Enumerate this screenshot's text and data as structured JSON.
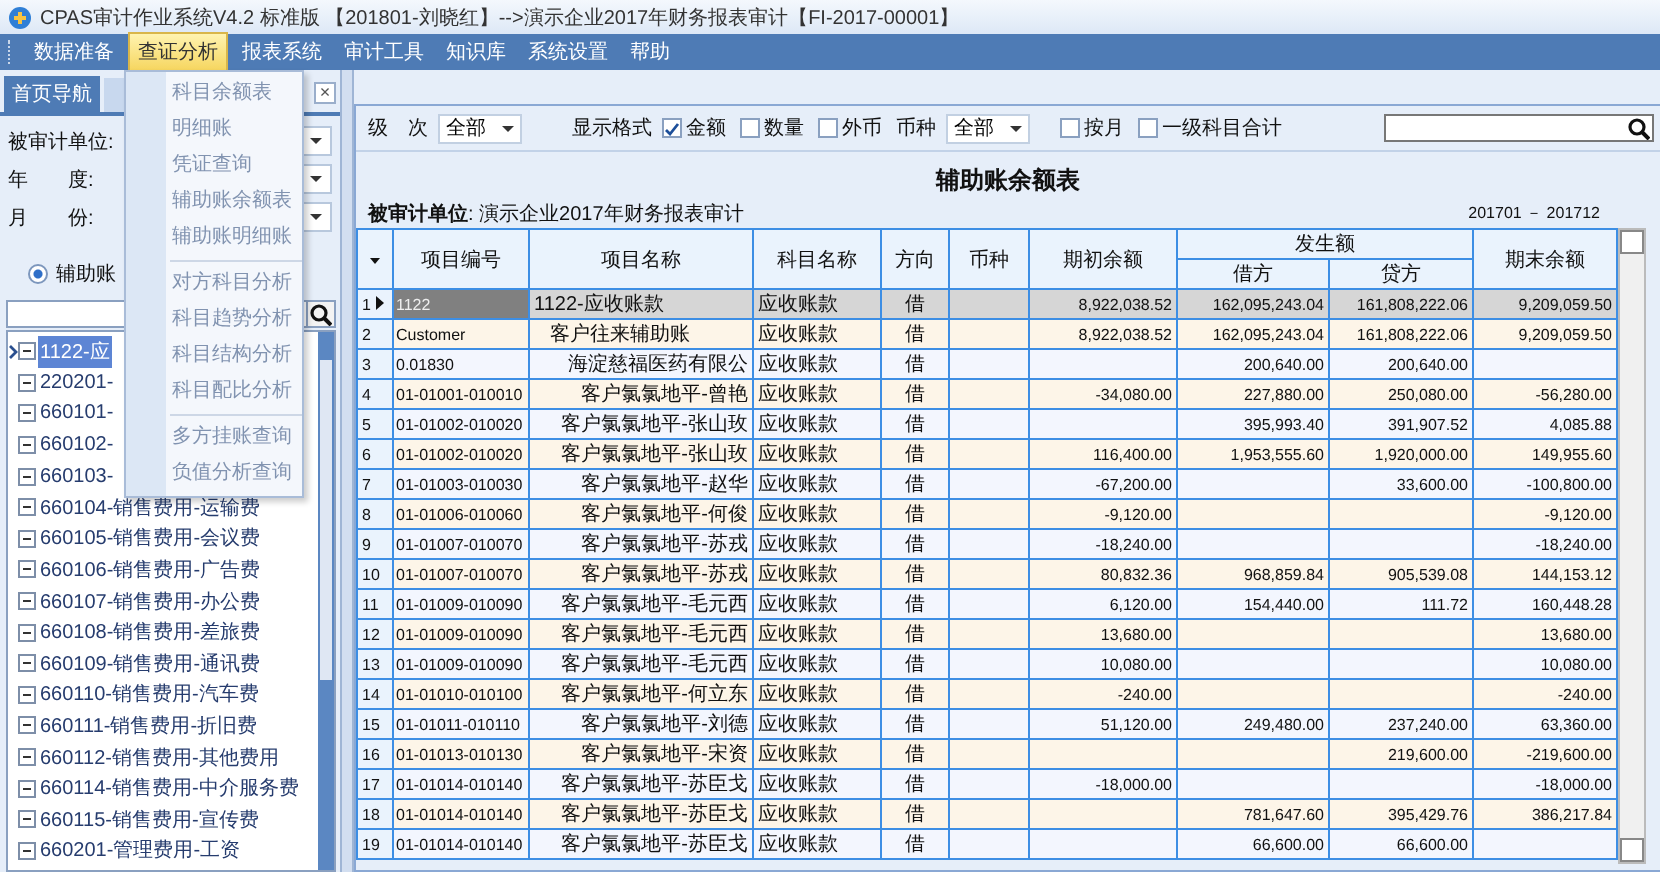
{
  "window": {
    "title": "CPAS审计作业系统V4.2 标准版 【201801-刘晓红】-->演示企业2017年财务报表审计【FI-2017-00001】"
  },
  "menu_bar": [
    {
      "label": "数据准备",
      "selected": false
    },
    {
      "label": "查证分析",
      "selected": true
    },
    {
      "label": "报表系统",
      "selected": false
    },
    {
      "label": "审计工具",
      "selected": false
    },
    {
      "label": "知识库",
      "selected": false
    },
    {
      "label": "系统设置",
      "selected": false
    },
    {
      "label": "帮助",
      "selected": false
    }
  ],
  "dropdown_menu": {
    "groups": [
      [
        "科目余额表",
        "明细账",
        "凭证查询",
        "辅助账余额表",
        "辅助账明细账"
      ],
      [
        "对方科目分析",
        "科目趋势分析",
        "科目结构分析",
        "科目配比分析"
      ],
      [
        "多方挂账查询",
        "负值分析查询"
      ]
    ]
  },
  "left_panel": {
    "tabs": [
      {
        "label": "首页导航",
        "selected": true
      }
    ],
    "tab_close": "×",
    "fields": [
      {
        "label": "被审计单位:"
      },
      {
        "label": "年　　度:"
      },
      {
        "label": "月　　份:"
      }
    ],
    "radio": {
      "label": "辅助账",
      "selected": true
    },
    "tree": [
      {
        "label": "1122-应",
        "selected": true,
        "expanded": true
      },
      {
        "label": "220201-",
        "selected": false,
        "expanded": true
      },
      {
        "label": "660101-",
        "selected": false,
        "expanded": true
      },
      {
        "label": "660102-",
        "selected": false,
        "expanded": true
      },
      {
        "label": "660103-",
        "selected": false,
        "expanded": true
      },
      {
        "label": "660104-销售费用-运输费",
        "selected": false,
        "expanded": true
      },
      {
        "label": "660105-销售费用-会议费",
        "selected": false,
        "expanded": true
      },
      {
        "label": "660106-销售费用-广告费",
        "selected": false,
        "expanded": true
      },
      {
        "label": "660107-销售费用-办公费",
        "selected": false,
        "expanded": true
      },
      {
        "label": "660108-销售费用-差旅费",
        "selected": false,
        "expanded": true
      },
      {
        "label": "660109-销售费用-通讯费",
        "selected": false,
        "expanded": true
      },
      {
        "label": "660110-销售费用-汽车费",
        "selected": false,
        "expanded": true
      },
      {
        "label": "660111-销售费用-折旧费",
        "selected": false,
        "expanded": true
      },
      {
        "label": "660112-销售费用-其他费用",
        "selected": false,
        "expanded": true
      },
      {
        "label": "660114-销售费用-中介服务费",
        "selected": false,
        "expanded": true
      },
      {
        "label": "660115-销售费用-宣传费",
        "selected": false,
        "expanded": true
      },
      {
        "label": "660201-管理费用-工资",
        "selected": false,
        "expanded": true
      }
    ]
  },
  "toolbar": {
    "level": {
      "label": "级　次",
      "value": "全部"
    },
    "format_label": "显示格式",
    "checkboxes": [
      {
        "label": "金额",
        "checked": true
      },
      {
        "label": "数量",
        "checked": false
      },
      {
        "label": "外币",
        "checked": false
      }
    ],
    "currency": {
      "label": "币种",
      "value": "全部"
    },
    "options": [
      {
        "label": "按月",
        "checked": false
      },
      {
        "label": "一级科目合计",
        "checked": false
      }
    ]
  },
  "report": {
    "title": "辅助账余额表",
    "unit": "**被审计单位**: 演示企业2017年财务报表审计",
    "period": "201701 － 201712"
  },
  "table": {
    "columns": [
      {
        "label": "项目编号"
      },
      {
        "label": "项目名称"
      },
      {
        "label": "科目名称"
      },
      {
        "label": "方向"
      },
      {
        "label": "币种"
      },
      {
        "label": "期初余额"
      },
      {
        "label": "发生额",
        "children": [
          {
            "label": "借方"
          },
          {
            "label": "贷方"
          }
        ]
      },
      {
        "label": "期末余额"
      }
    ],
    "rows": [
      {
        "number": "1",
        "selected": true,
        "kind": "total",
        "id": "1122",
        "name": "1122-应收账款",
        "subject": "应收账款",
        "direction": "借",
        "opening": "8,922,038.52",
        "debit": "162,095,243.04",
        "credit": "161,808,222.06",
        "closing": "9,209,059.50"
      },
      {
        "number": "2",
        "selected": false,
        "kind": "group",
        "id": "Customer",
        "name": "客户往来辅助账",
        "subject": "应收账款",
        "direction": "借",
        "opening": "8,922,038.52",
        "debit": "162,095,243.04",
        "credit": "161,808,222.06",
        "closing": "9,209,059.50"
      },
      {
        "number": "3",
        "selected": false,
        "kind": "item",
        "id": "0.01830",
        "name": "海淀慈福医药有限公",
        "subject": "应收账款",
        "direction": "借",
        "debit": "200,640.00",
        "credit": "200,640.00"
      },
      {
        "number": "4",
        "selected": false,
        "kind": "item",
        "id": "01-01001-010010",
        "name": "客户氯氯地平-曾艳",
        "subject": "应收账款",
        "direction": "借",
        "opening": "-34,080.00",
        "debit": "227,880.00",
        "credit": "250,080.00",
        "closing": "-56,280.00"
      },
      {
        "number": "5",
        "selected": false,
        "kind": "item",
        "id": "01-01002-010020",
        "name": "客户氯氯地平-张山玫",
        "subject": "应收账款",
        "direction": "借",
        "debit": "395,993.40",
        "credit": "391,907.52",
        "closing": "4,085.88"
      },
      {
        "number": "6",
        "selected": false,
        "kind": "item",
        "id": "01-01002-010020",
        "name": "客户氯氯地平-张山玫",
        "subject": "应收账款",
        "direction": "借",
        "opening": "116,400.00",
        "debit": "1,953,555.60",
        "credit": "1,920,000.00",
        "closing": "149,955.60"
      },
      {
        "number": "7",
        "selected": false,
        "kind": "item",
        "id": "01-01003-010030",
        "name": "客户氯氯地平-赵华",
        "subject": "应收账款",
        "direction": "借",
        "opening": "-67,200.00",
        "credit": "33,600.00",
        "closing": "-100,800.00"
      },
      {
        "number": "8",
        "selected": false,
        "kind": "item",
        "id": "01-01006-010060",
        "name": "客户氯氯地平-何俊",
        "subject": "应收账款",
        "direction": "借",
        "opening": "-9,120.00",
        "closing": "-9,120.00"
      },
      {
        "number": "9",
        "selected": false,
        "kind": "item",
        "id": "01-01007-010070",
        "name": "客户氯氯地平-苏戎",
        "subject": "应收账款",
        "direction": "借",
        "opening": "-18,240.00",
        "closing": "-18,240.00"
      },
      {
        "number": "10",
        "selected": false,
        "kind": "item",
        "id": "01-01007-010070",
        "name": "客户氯氯地平-苏戎",
        "subject": "应收账款",
        "direction": "借",
        "opening": "80,832.36",
        "debit": "968,859.84",
        "credit": "905,539.08",
        "closing": "144,153.12"
      },
      {
        "number": "11",
        "selected": false,
        "kind": "item",
        "id": "01-01009-010090",
        "name": "客户氯氯地平-毛元西",
        "subject": "应收账款",
        "direction": "借",
        "opening": "6,120.00",
        "debit": "154,440.00",
        "credit": "111.72",
        "closing": "160,448.28"
      },
      {
        "number": "12",
        "selected": false,
        "kind": "item",
        "id": "01-01009-010090",
        "name": "客户氯氯地平-毛元西",
        "subject": "应收账款",
        "direction": "借",
        "opening": "13,680.00",
        "closing": "13,680.00"
      },
      {
        "number": "13",
        "selected": false,
        "kind": "item",
        "id": "01-01009-010090",
        "name": "客户氯氯地平-毛元西",
        "subject": "应收账款",
        "direction": "借",
        "opening": "10,080.00",
        "closing": "10,080.00"
      },
      {
        "number": "14",
        "selected": false,
        "kind": "item",
        "id": "01-01010-010100",
        "name": "客户氯氯地平-何立东",
        "subject": "应收账款",
        "direction": "借",
        "opening": "-240.00",
        "closing": "-240.00"
      },
      {
        "number": "15",
        "selected": false,
        "kind": "item",
        "id": "01-01011-010110",
        "name": "客户氯氯地平-刘德",
        "subject": "应收账款",
        "direction": "借",
        "opening": "51,120.00",
        "debit": "249,480.00",
        "credit": "237,240.00",
        "closing": "63,360.00"
      },
      {
        "number": "16",
        "selected": false,
        "kind": "item",
        "id": "01-01013-010130",
        "name": "客户氯氯地平-宋资",
        "subject": "应收账款",
        "direction": "借",
        "credit": "219,600.00",
        "closing": "-219,600.00"
      },
      {
        "number": "17",
        "selected": false,
        "kind": "item",
        "id": "01-01014-010140",
        "name": "客户氯氯地平-苏臣戈",
        "subject": "应收账款",
        "direction": "借",
        "opening": "-18,000.00",
        "closing": "-18,000.00"
      },
      {
        "number": "18",
        "selected": false,
        "kind": "item",
        "id": "01-01014-010140",
        "name": "客户氯氯地平-苏臣戈",
        "subject": "应收账款",
        "direction": "借",
        "debit": "781,647.60",
        "credit": "395,429.76",
        "closing": "386,217.84"
      },
      {
        "number": "19",
        "selected": false,
        "kind": "item",
        "id": "01-01014-010140",
        "name": "客户氯氯地平-苏臣戈",
        "subject": "应收账款",
        "direction": "借",
        "debit": "66,600.00",
        "credit": "66,600.00"
      }
    ]
  }
}
